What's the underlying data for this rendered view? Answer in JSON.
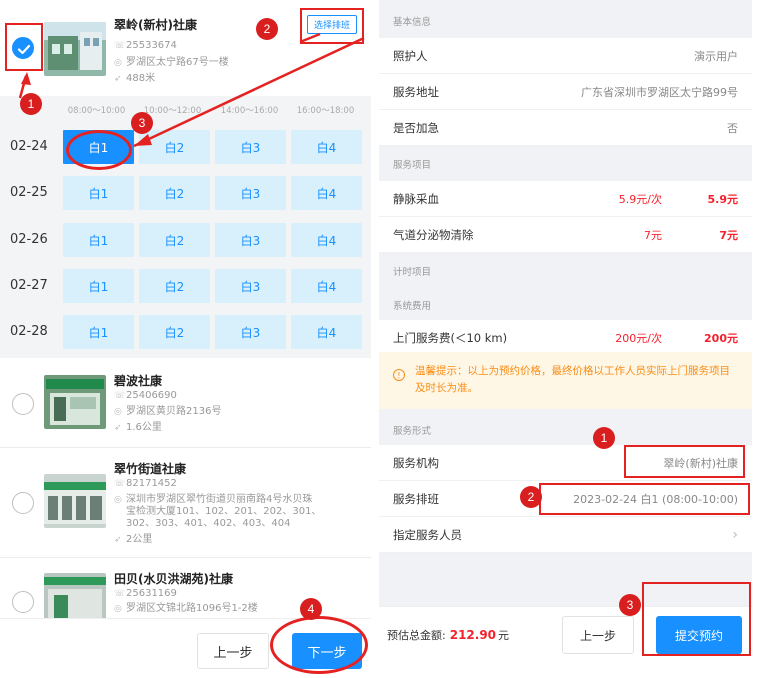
{
  "left": {
    "centers": [
      {
        "name": "翠岭(新村)社康",
        "phone": "25533674",
        "address": "罗湖区太宁路67号一楼",
        "distance": "488米",
        "selected": true,
        "pick_label": "选择排班"
      },
      {
        "name": "碧波社康",
        "phone": "25406690",
        "address": "罗湖区黄贝路2136号",
        "distance": "1.6公里",
        "selected": false
      },
      {
        "name": "翠竹街道社康",
        "phone": "82171452",
        "address_lines": [
          "深圳市罗湖区翠竹街道贝丽南路4号水贝珠",
          "宝检测大厦101、102、201、202、301、",
          "302、303、401、402、403、404"
        ],
        "distance": "2公里",
        "selected": false
      },
      {
        "name": "田贝(水贝洪湖苑)社康",
        "phone": "25631169",
        "address": "罗湖区文锦北路1096号1-2楼",
        "selected": false
      }
    ],
    "schedule": {
      "time_slots": [
        "08:00～10:00",
        "10:00～12:00",
        "14:00～16:00",
        "16:00～18:00"
      ],
      "rows": [
        {
          "date": "02-24",
          "slots": [
            "白1",
            "白2",
            "白3",
            "白4"
          ]
        },
        {
          "date": "02-25",
          "slots": [
            "白1",
            "白2",
            "白3",
            "白4"
          ]
        },
        {
          "date": "02-26",
          "slots": [
            "白1",
            "白2",
            "白3",
            "白4"
          ]
        },
        {
          "date": "02-27",
          "slots": [
            "白1",
            "白2",
            "白3",
            "白4"
          ]
        },
        {
          "date": "02-28",
          "slots": [
            "白1",
            "白2",
            "白3",
            "白4"
          ]
        }
      ],
      "selected": {
        "date": "02-24",
        "slot": "白1"
      }
    },
    "footer": {
      "prev": "上一步",
      "next": "下一步"
    }
  },
  "right": {
    "basic_info": {
      "header": "基本信息",
      "rows": [
        {
          "label": "照护人",
          "value": "演示用户"
        },
        {
          "label": "服务地址",
          "value": "广东省深圳市罗湖区太宁路99号"
        },
        {
          "label": "是否加急",
          "value": "否"
        }
      ]
    },
    "service_items": {
      "header": "服务项目",
      "rows": [
        {
          "label": "静脉采血",
          "unit_price": "5.9元/次",
          "total": "5.9元"
        },
        {
          "label": "气道分泌物清除",
          "unit_price": "7元",
          "total": "7元"
        }
      ]
    },
    "timed_items": {
      "header": "计时项目"
    },
    "system_fees": {
      "header": "系统费用",
      "rows": [
        {
          "label": "上门服务费(＜10 km)",
          "unit_price": "200元/次",
          "total": "200元"
        }
      ]
    },
    "tip": "温馨提示：以上为预约价格，最终价格以工作人员实际上门服务项目及时长为准。",
    "service_form": {
      "header": "服务形式",
      "org_label": "服务机构",
      "org_value": "翠岭(新村)社康",
      "schedule_label": "服务排班",
      "schedule_value": "2023-02-24 白1 (08:00-10:00)",
      "staff_label": "指定服务人员"
    },
    "footer": {
      "total_label": "预估总金额:",
      "total_amount": "212.90",
      "total_unit": "元",
      "prev": "上一步",
      "submit": "提交预约"
    }
  },
  "annotations": [
    "1",
    "2",
    "3",
    "4",
    "1",
    "2",
    "3"
  ],
  "colors": {
    "primary": "#1890ff",
    "price": "#f5222d",
    "annotation": "#e52222",
    "tip": "#fa8c16"
  }
}
